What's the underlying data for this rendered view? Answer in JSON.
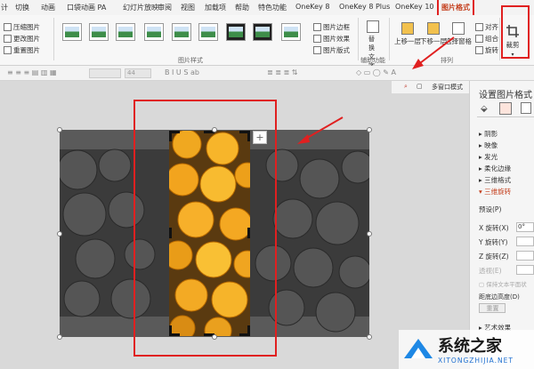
{
  "tabs": [
    "计",
    "切换",
    "动画",
    "口袋动画 PA",
    "幻灯片放映",
    "审阅",
    "视图",
    "加载项",
    "帮助",
    "特色功能",
    "OneKey 8",
    "OneKey 8 Plus",
    "OneKey 10",
    "图片格式"
  ],
  "ribbon": {
    "adjust": [
      "压缩图片",
      "更改图片",
      "重置图片"
    ],
    "styles_group": "图片样式",
    "border": "图片边框",
    "effects": "图片效果",
    "layout": "图片版式",
    "access_group": "辅助功能",
    "alt_text": "替换文字",
    "arrange_group": "排列",
    "bring_forward": "上移一层",
    "send_backward": "下移一层",
    "selection_pane": "选择窗格",
    "align": "对齐",
    "group": "组合",
    "rotate": "旋转",
    "crop": "裁剪"
  },
  "toolbar": {
    "font_size": "44",
    "multi_window": "多窗口模式"
  },
  "panel": {
    "title": "设置图片格式",
    "sections": [
      "阴影",
      "映像",
      "发光",
      "柔化边缘",
      "三维格式"
    ],
    "active_section": "三维旋转",
    "preset": "预设(P)",
    "x_rotation": "X 旋转(X)",
    "x_value": "0°",
    "y_rotation": "Y 旋转(Y)",
    "z_rotation": "Z 旋转(Z)",
    "perspective": "透视(E)",
    "keep_flat": "保持文本平面状",
    "distance": "距底边高度(D)",
    "reset": "重置",
    "artistic": "艺术效果"
  },
  "watermark": {
    "brand": "系统之家",
    "url": "XITONGZHIJIA.NET"
  },
  "colors": {
    "accent": "#c43e1c",
    "annotation": "#e02020"
  }
}
